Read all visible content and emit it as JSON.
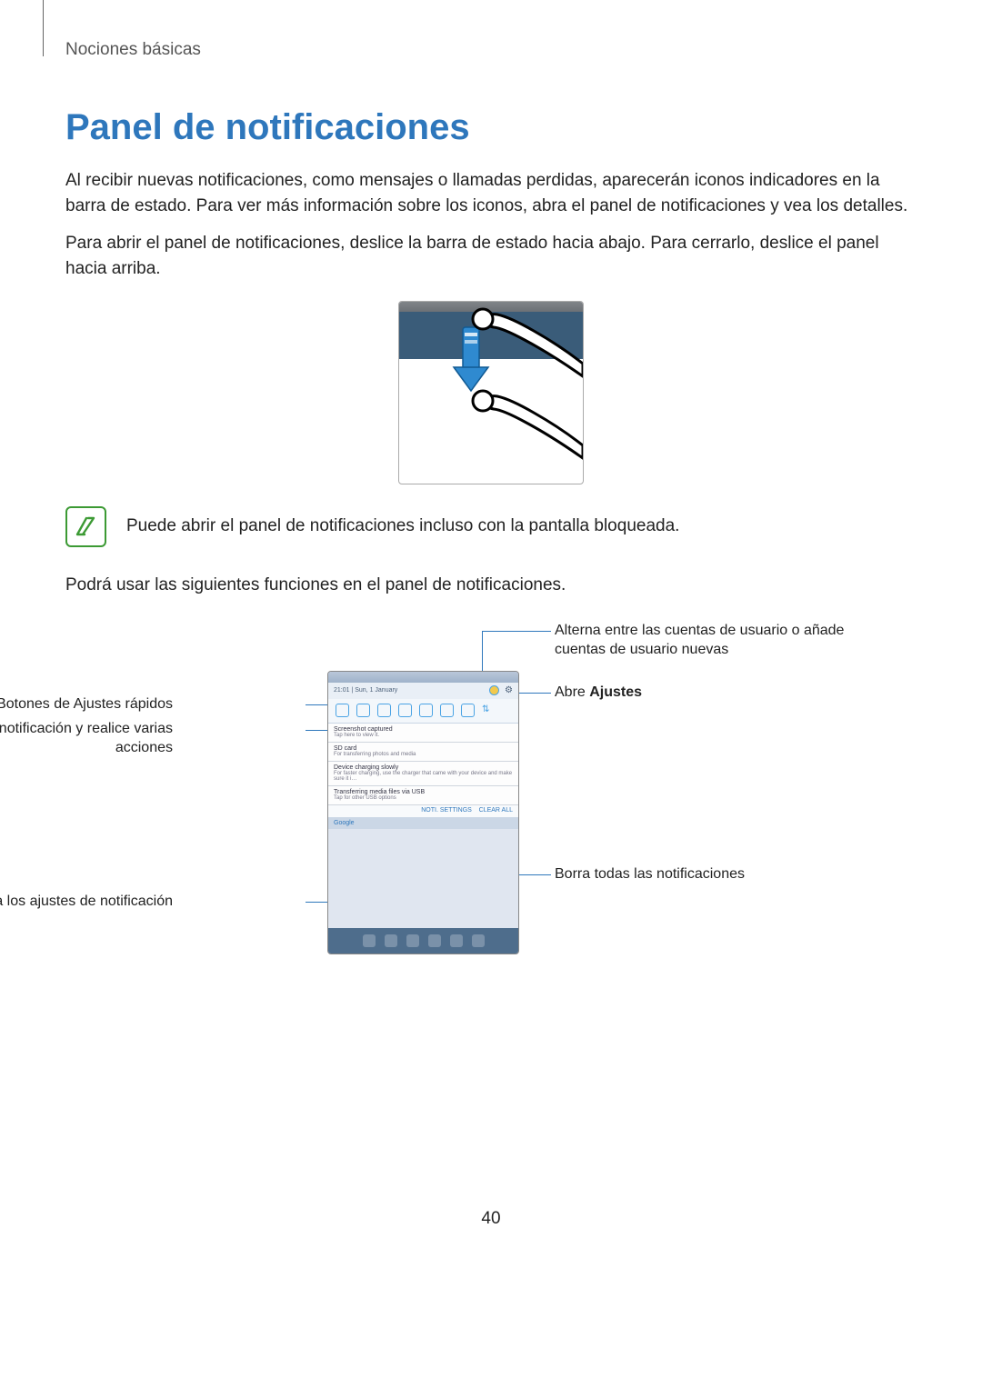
{
  "section": "Nociones básicas",
  "title": "Panel de notificaciones",
  "para1": "Al recibir nuevas notificaciones, como mensajes o llamadas perdidas, aparecerán iconos indicadores en la barra de estado. Para ver más información sobre los iconos, abra el panel de notificaciones y vea los detalles.",
  "para2": "Para abrir el panel de notificaciones, deslice la barra de estado hacia abajo. Para cerrarlo, deslice el panel hacia arriba.",
  "note": "Puede abrir el panel de notificaciones incluso con la pantalla bloqueada.",
  "para3": "Podrá usar las siguientes funciones en el panel de notificaciones.",
  "callouts": {
    "quick_settings": "Botones de Ajustes rápidos",
    "tap_notif": "Pulse una notificación y realice varias acciones",
    "notif_settings": "Accede a los ajustes de notificación",
    "switch_user": "Alterna entre las cuentas de usuario o añade cuentas de usuario nuevas",
    "open_settings_pre": "Abre ",
    "open_settings_bold": "Ajustes",
    "clear_all": "Borra todas las notificaciones"
  },
  "phone": {
    "time_date": "21:01 | Sun, 1 January",
    "n1_title": "Screenshot captured",
    "n1_sub": "Tap here to view it.",
    "n2_title": "SD card",
    "n2_sub": "For transferring photos and media",
    "n3_title": "Device charging slowly",
    "n3_sub": "For faster charging, use the charger that came with your device and make sure it i…",
    "n4_title": "Transferring media files via USB",
    "n4_sub": "Tap for other USB options",
    "actions_left": "NOTI. SETTINGS",
    "actions_right": "CLEAR ALL",
    "search": "Google"
  },
  "page_number": "40"
}
